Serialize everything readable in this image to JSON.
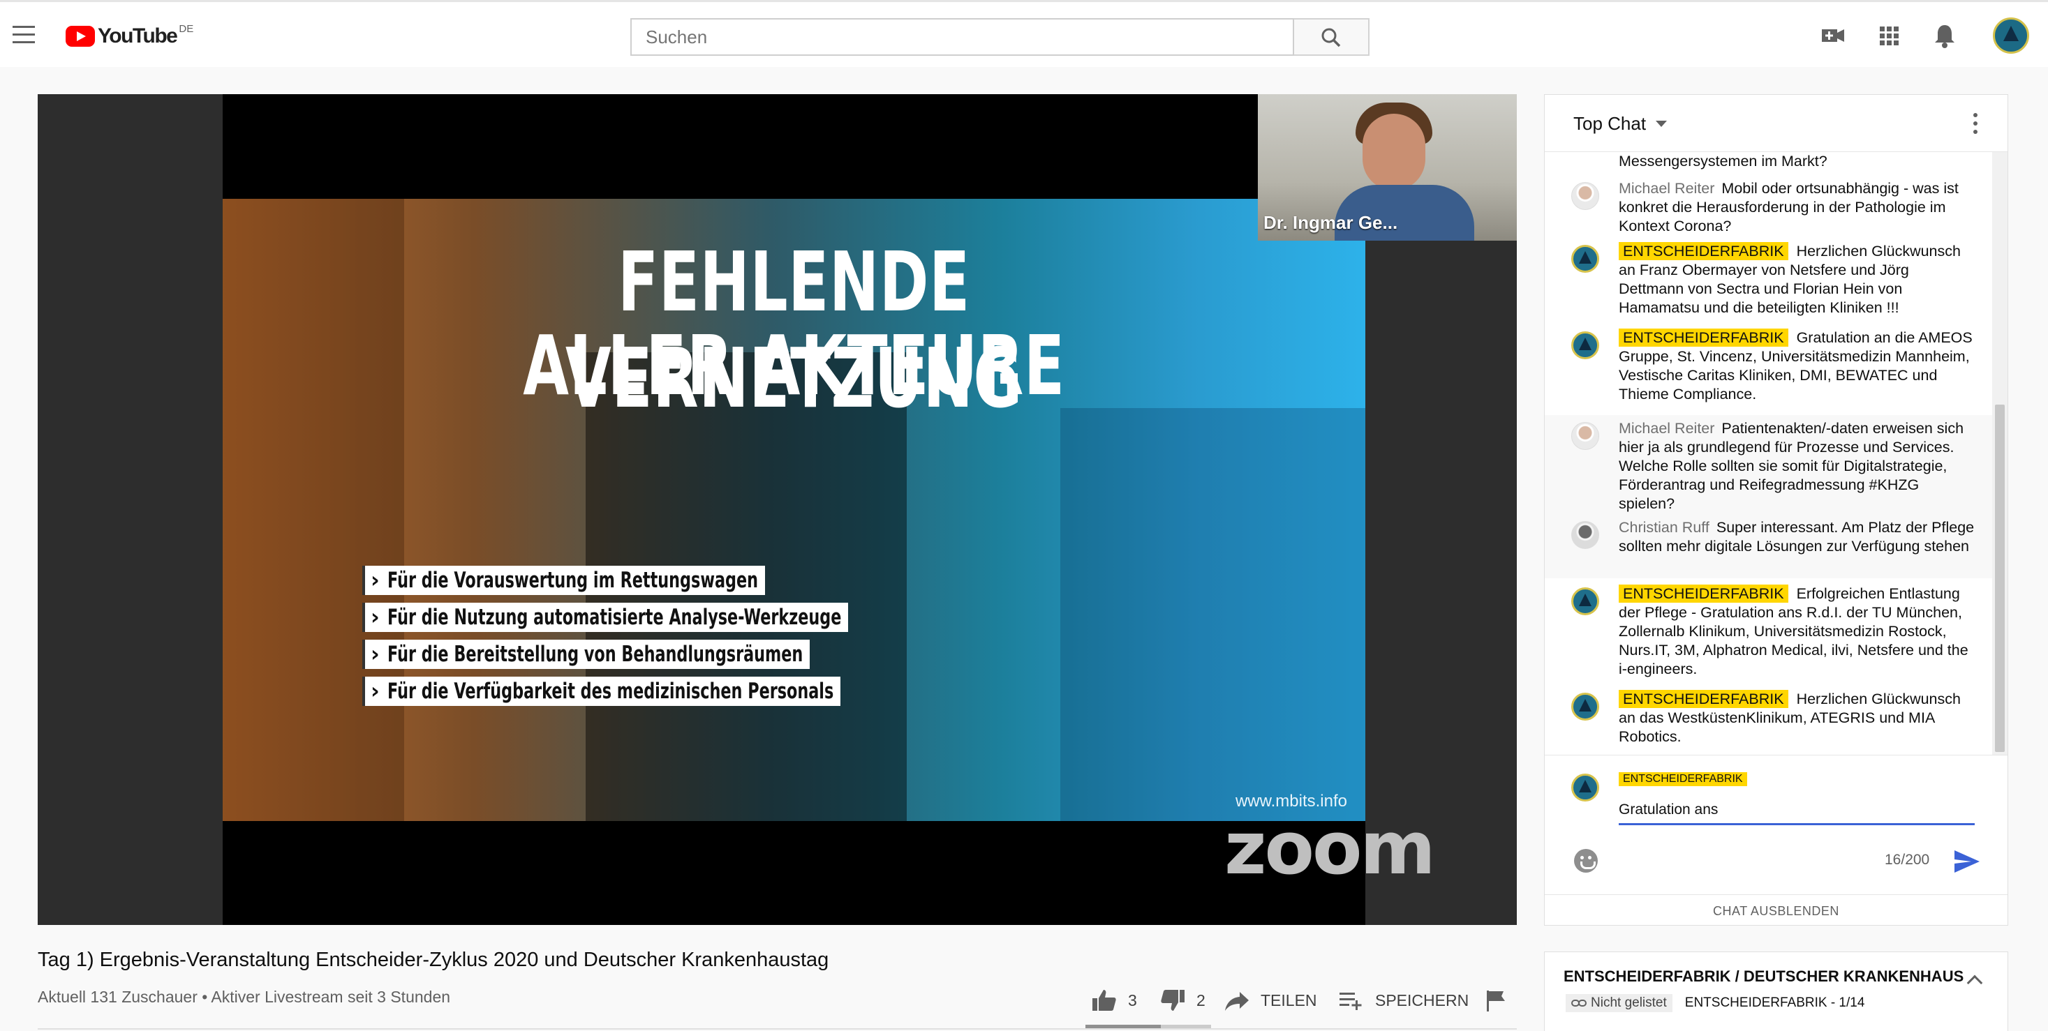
{
  "header": {
    "logo_text": "YouTube",
    "country": "DE",
    "search_placeholder": "Suchen",
    "icons": [
      "menu-icon",
      "search-icon",
      "create-video-icon",
      "apps-icon",
      "notifications-icon"
    ]
  },
  "player": {
    "slide_title_line1": "FEHLENDE VERNETZUNG",
    "slide_title_line2": "ALLER AKTEURE",
    "bullets": [
      "Für die Vorauswertung im Rettungswagen",
      "Für die Nutzung automatisierte Analyse-Werkzeuge",
      "Für die Bereitstellung von Behandlungsräumen",
      "Für die Verfügbarkeit des medizinischen Personals"
    ],
    "watermark_site": "www.mbits.info",
    "speaker_name": "Dr. Ingmar Ge...",
    "zoom_logo": "zoom"
  },
  "video": {
    "title": "Tag 1) Ergebnis-Veranstaltung Entscheider-Zyklus 2020 und Deutscher Krankenhaustag",
    "meta": "Aktuell 131 Zuschauer • Aktiver Livestream seit 3 Stunden",
    "likes": "3",
    "dislikes": "2",
    "like_ratio": 0.6,
    "share_label": "TEILEN",
    "save_label": "SPEICHERN"
  },
  "chat": {
    "title": "Top Chat",
    "messages": [
      {
        "author": "",
        "text": "Messengersystemen im Markt?"
      },
      {
        "author": "Michael Reiter",
        "text": "Mobil oder ortsunabhängig - was ist konkret die Herausforderung in der Pathologie im Kontext Corona?"
      },
      {
        "author": "ENTSCHEIDERFABRIK",
        "text": "Herzlichen Glückwunsch an Franz Obermayer von Netsfere und Jörg Dettmann von Sectra und Florian Hein von Hamamatsu und die beteiligten Kliniken !!!"
      },
      {
        "author": "ENTSCHEIDERFABRIK",
        "text": "Gratulation an die AMEOS Gruppe, St. Vincenz, Universitätsmedizin Mannheim, Vestische Caritas Kliniken, DMI, BEWATEC und Thieme Compliance."
      },
      {
        "author": "Michael Reiter",
        "text": "Patientenakten/-daten erweisen sich hier ja als grundlegend für Prozesse und Services. Welche Rolle sollten sie somit für Digitalstrategie, Förderantrag und Reifegradmessung #KHZG spielen?"
      },
      {
        "author": "Christian Ruff",
        "text": "Super interessant. Am Platz der Pflege sollten mehr digitale Lösungen zur Verfügung stehen"
      },
      {
        "author": "ENTSCHEIDERFABRIK",
        "text": "Erfolgreichen Entlastung der Pflege - Gratulation ans R.d.I. der TU München, Zollernalb Klinikum, Universitätsmedizin Rostock, Nurs.IT, 3M, Alphatron Medical, ilvi, Netsfere und the i-engineers."
      },
      {
        "author": "ENTSCHEIDERFABRIK",
        "text": "Herzlichen Glückwunsch an das WestküstenKlinikum, ATEGRIS und MIA Robotics."
      }
    ],
    "composer_author": "ENTSCHEIDERFABRIK",
    "composer_value": "Gratulation ans",
    "char_count": "16/200",
    "hide_label": "CHAT AUSBLENDEN"
  },
  "playlist": {
    "title": "ENTSCHEIDERFABRIK / DEUTSCHER KRANKENHAUS",
    "visibility": "Nicht gelistet",
    "position": "ENTSCHEIDERFABRIK - 1/14"
  },
  "colors": {
    "brand_red": "#ff0000",
    "owner_badge": "#ffd600",
    "input_underline": "#3b62d6"
  }
}
